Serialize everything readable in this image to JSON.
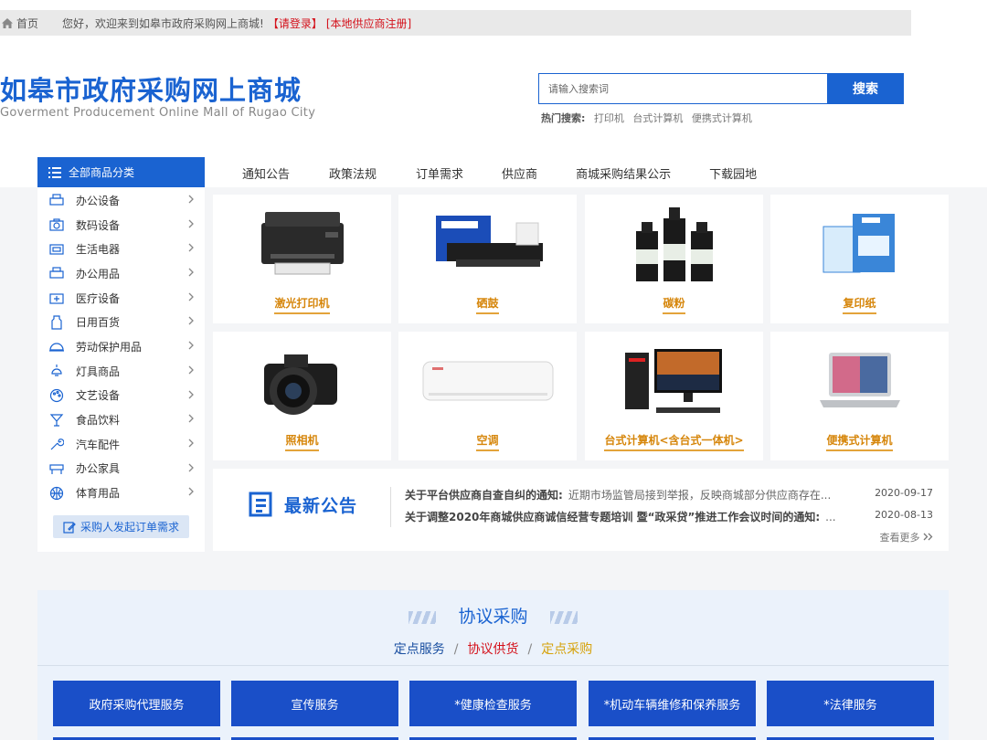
{
  "topbar": {
    "home": "首页",
    "welcome": "您好，欢迎来到如皋市政府采购网上商城!",
    "login": "【请登录】",
    "register": "[本地供应商注册]"
  },
  "header": {
    "title": "如皋市政府采购网上商城",
    "subtitle": "Goverment Producement Online Mall of Rugao City"
  },
  "search": {
    "placeholder": "请输入搜索词",
    "button": "搜索",
    "hot_label": "热门搜索:",
    "hot_keywords": [
      "打印机",
      "台式计算机",
      "便携式计算机"
    ]
  },
  "nav": {
    "items": [
      "通知公告",
      "政策法规",
      "订单需求",
      "供应商",
      "商城采购结果公示",
      "下载园地"
    ]
  },
  "sidebar": {
    "header": "全部商品分类",
    "items": [
      "办公设备",
      "数码设备",
      "生活电器",
      "办公用品",
      "医疗设备",
      "日用百货",
      "劳动保护用品",
      "灯具商品",
      "文艺设备",
      "食品饮料",
      "汽车配件",
      "办公家具",
      "体育用品"
    ],
    "button": "采购人发起订单需求"
  },
  "products": [
    "激光打印机",
    "硒鼓",
    "碳粉",
    "复印纸",
    "照相机",
    "空调",
    "台式计算机<含台式一体机>",
    "便携式计算机"
  ],
  "notice": {
    "brand": "最新公告",
    "rows": [
      {
        "title": "关于平台供应商自查自纠的通知:",
        "summary": "近期市场监管局接到举报，反映商城部分供应商存在...",
        "date": "2020-09-17"
      },
      {
        "title": "关于调整2020年商城供应商诚信经营专题培训 暨“政采贷”推进工作会议时间的通知:",
        "summary": "...",
        "date": "2020-08-13"
      }
    ],
    "more": "查看更多"
  },
  "agreement": {
    "title": "协议采购",
    "tabs": [
      "定点服务",
      "协议供货",
      "定点采购"
    ],
    "tab_colors": [
      "#1a4fa0",
      "#d4111b",
      "#d6a20b"
    ],
    "services": [
      "政府采购代理服务",
      "宣传服务",
      "*健康检查服务",
      "*机动车辆维修和保养服务",
      "*法律服务"
    ]
  },
  "colors": {
    "brand_blue": "#1a63d1",
    "product_label": "#d6860b",
    "red": "#d4111b"
  }
}
